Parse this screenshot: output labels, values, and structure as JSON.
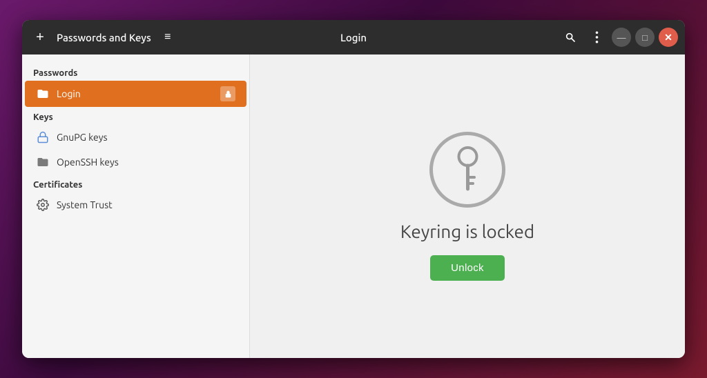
{
  "titlebar": {
    "add_button_label": "+",
    "app_title": "Passwords and Keys",
    "hamburger_label": "≡",
    "window_title": "Login",
    "search_tooltip": "Search",
    "menu_tooltip": "Menu",
    "minimize_label": "—",
    "maximize_label": "□",
    "close_label": "✕"
  },
  "sidebar": {
    "passwords_section": "Passwords",
    "keys_section": "Keys",
    "certificates_section": "Certificates",
    "items": [
      {
        "id": "login",
        "label": "Login",
        "icon": "folder",
        "active": true,
        "locked": true
      },
      {
        "id": "gnupg",
        "label": "GnuPG keys",
        "icon": "key-gnupg",
        "active": false
      },
      {
        "id": "openssh",
        "label": "OpenSSH keys",
        "icon": "folder-ssh",
        "active": false
      },
      {
        "id": "system-trust",
        "label": "System Trust",
        "icon": "gear",
        "active": false
      }
    ]
  },
  "content": {
    "keyring_locked_text": "Keyring is locked",
    "unlock_button_label": "Unlock"
  },
  "colors": {
    "active_bg": "#e07020",
    "unlock_btn": "#4caf50",
    "close_btn": "#e05c4b"
  }
}
